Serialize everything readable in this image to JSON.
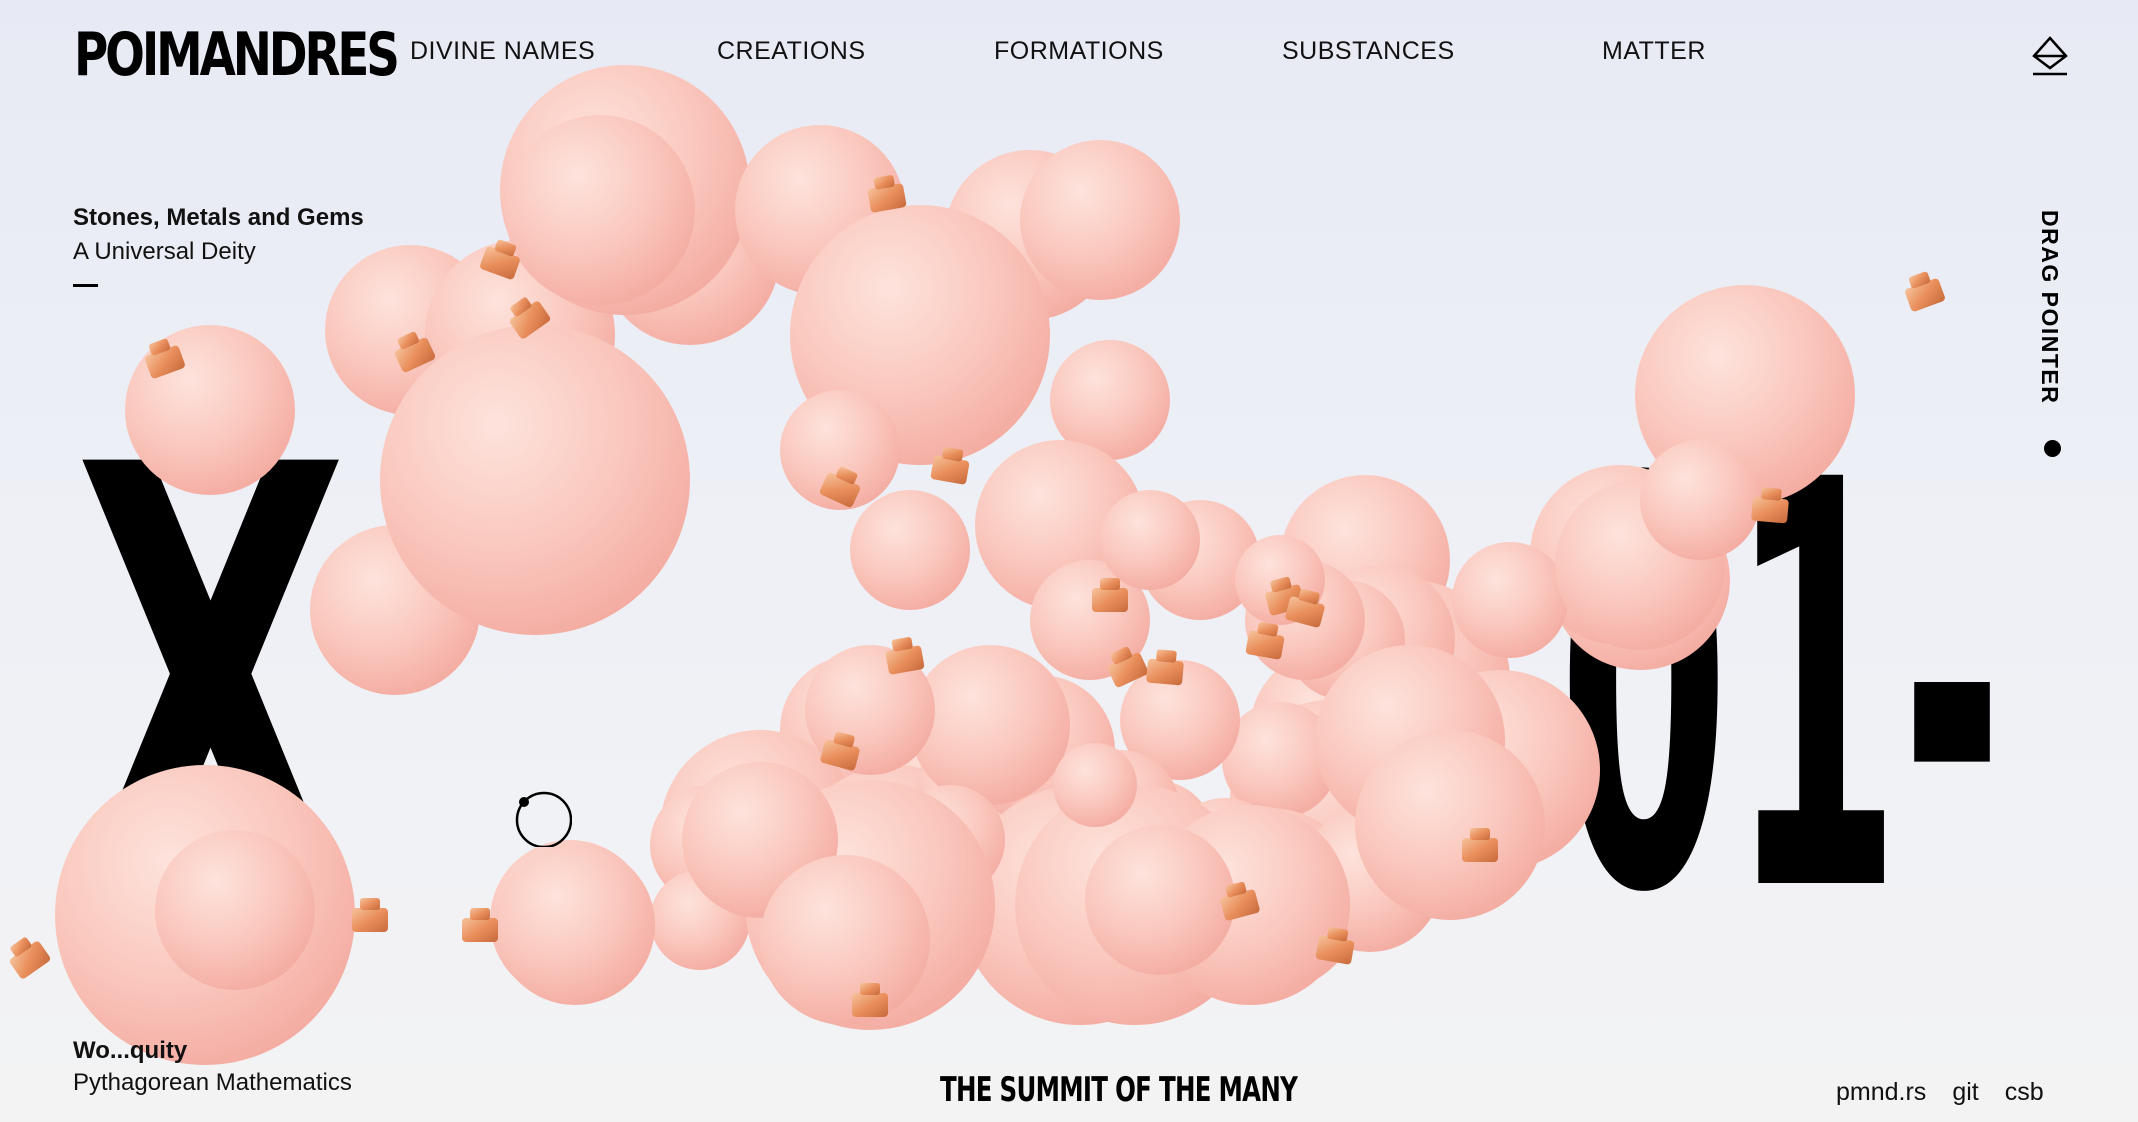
{
  "header": {
    "logo": "POIMANDRES",
    "nav": [
      {
        "label": "DIVINE NAMES"
      },
      {
        "label": "CREATIONS"
      },
      {
        "label": "FORMATIONS"
      },
      {
        "label": "SUBSTANCES"
      },
      {
        "label": "MATTER"
      }
    ],
    "brand_icon": "diamond-icon"
  },
  "intro": {
    "title": "Stones, Metals and Gems",
    "subtitle": "A Universal Deity"
  },
  "display": {
    "glyph": "X",
    "counter": "01-"
  },
  "sidebar": {
    "cta": "DRAG POINTER"
  },
  "footer": {
    "title": "Wo...quity",
    "subtitle": "Pythagorean Mathematics",
    "tagline": "THE SUMMIT OF THE MANY",
    "links": [
      "pmnd.rs",
      "git",
      "csb"
    ]
  },
  "colors": {
    "orb": "#f7b6ad",
    "orb_highlight": "#fde3dc",
    "cap": "#e98f5c",
    "background_top": "#e7eaf4",
    "background_bottom": "#f3f3f4"
  }
}
